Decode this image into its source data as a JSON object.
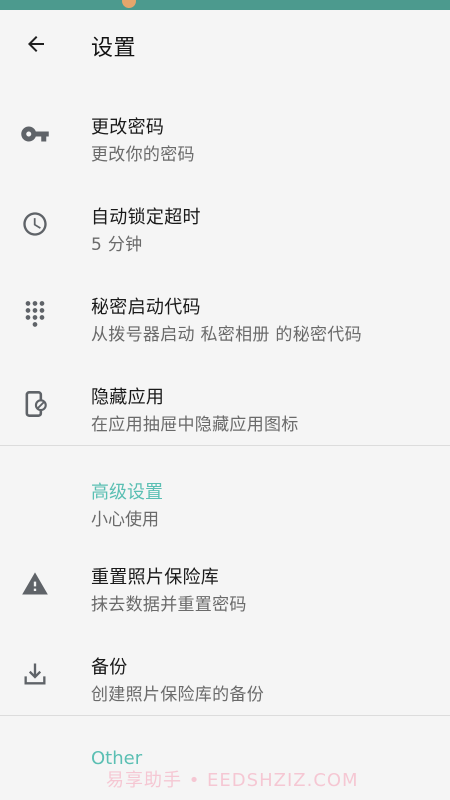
{
  "app": {
    "title": "设置",
    "back_icon": "arrow-left-icon"
  },
  "colors": {
    "accent": "#5bbfb3",
    "statusbar": "#4c9a8e",
    "icon": "#5f6368"
  },
  "settings": [
    {
      "icon": "key-icon",
      "title": "更改密码",
      "subtitle": "更改你的密码"
    },
    {
      "icon": "clock-icon",
      "title": "自动锁定超时",
      "subtitle": "5 分钟"
    },
    {
      "icon": "dialpad-icon",
      "title": "秘密启动代码",
      "subtitle": "从拨号器启动 私密相册 的秘密代码"
    },
    {
      "icon": "hide-app-icon",
      "title": "隐藏应用",
      "subtitle": "在应用抽屉中隐藏应用图标"
    }
  ],
  "advanced": {
    "header": "高级设置",
    "subtitle": "小心使用",
    "items": [
      {
        "icon": "warning-icon",
        "title": "重置照片保险库",
        "subtitle": "抹去数据并重置密码"
      },
      {
        "icon": "download-icon",
        "title": "备份",
        "subtitle": "创建照片保险库的备份"
      }
    ]
  },
  "other": {
    "header": "Other"
  },
  "watermark": "易享助手 • EEDSHZIZ.COM"
}
